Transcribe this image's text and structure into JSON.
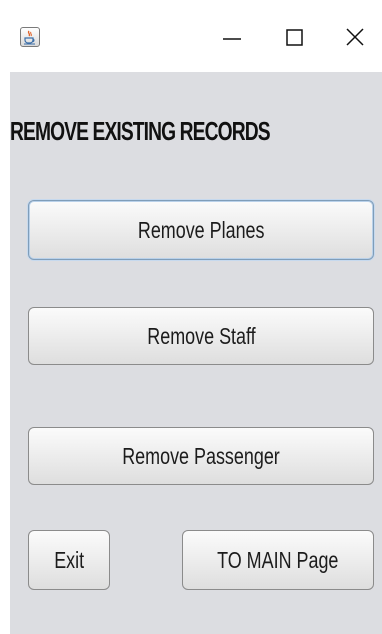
{
  "window": {
    "icon": "java-cup-icon",
    "controls": {
      "minimize_icon": "minimize-icon",
      "maximize_icon": "maximize-icon",
      "close_icon": "close-icon"
    }
  },
  "heading": "REMOVE EXISTING RECORDS",
  "buttons": {
    "remove_planes": "Remove Planes",
    "remove_staff": "Remove Staff",
    "remove_passenger": "Remove Passenger",
    "exit": "Exit",
    "to_main": "TO MAIN Page"
  },
  "colors": {
    "panel_background": "#dcdde1",
    "titlebar_background": "#ffffff",
    "focus_border": "#7f9db9"
  }
}
